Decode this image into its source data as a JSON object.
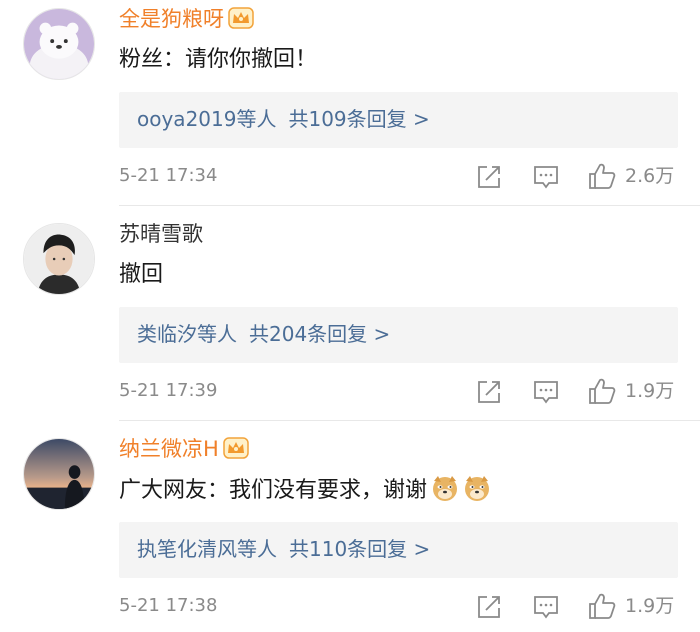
{
  "comments": [
    {
      "username": "全是狗粮呀",
      "vip": true,
      "content": "粉丝：请你你撤回！",
      "reply_users": "ooya2019等人",
      "reply_count": "共109条回复 >",
      "time": "5-21 17:34",
      "likes": "2.6万"
    },
    {
      "username": "苏晴雪歌",
      "vip": false,
      "content": "撤回",
      "reply_users": "类临汐等人",
      "reply_count": "共204条回复 >",
      "time": "5-21 17:39",
      "likes": "1.9万"
    },
    {
      "username": "纳兰微凉H",
      "vip": true,
      "content": "广大网友：我们没有要求，谢谢",
      "emojis": [
        "doge-emoji",
        "doge-emoji"
      ],
      "reply_users": "执笔化清风等人",
      "reply_count": "共110条回复 >",
      "time": "5-21 17:38",
      "likes": "1.9万"
    }
  ],
  "colors": {
    "vip_name": "#f0802a",
    "link": "#4b6d96",
    "meta": "#8a8a8a",
    "reply_bg": "#f4f4f4"
  },
  "icons": {
    "vip": "crown-icon",
    "share": "share-icon",
    "reply": "comment-icon",
    "like": "thumbs-up-icon"
  }
}
